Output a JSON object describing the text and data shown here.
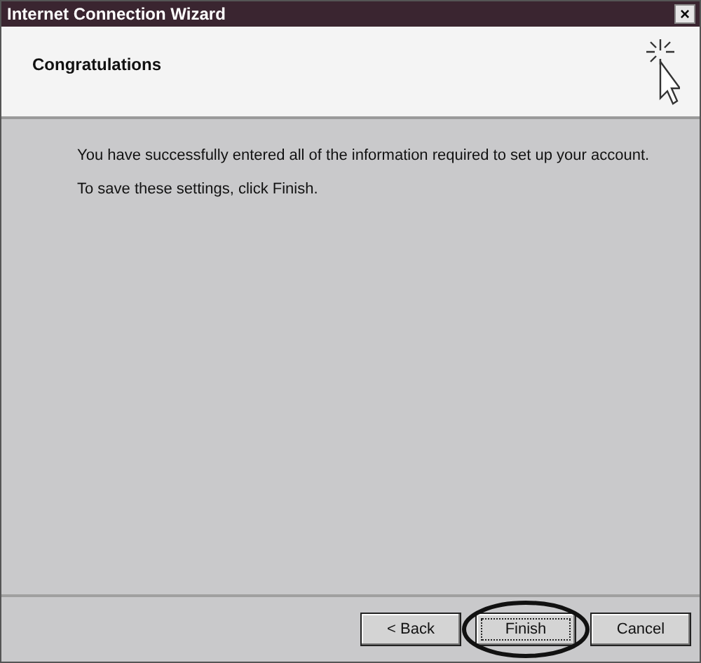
{
  "window": {
    "title": "Internet Connection Wizard",
    "close_label": "×"
  },
  "header": {
    "title": "Congratulations"
  },
  "body": {
    "paragraphs": [
      "You have successfully entered all of the information required to set up your account.",
      "To save these settings, click Finish."
    ]
  },
  "buttons": [
    {
      "label": "< Back",
      "focused": false,
      "circled": false
    },
    {
      "label": "Finish",
      "focused": true,
      "circled": true
    },
    {
      "label": "Cancel",
      "focused": false,
      "circled": false
    }
  ]
}
